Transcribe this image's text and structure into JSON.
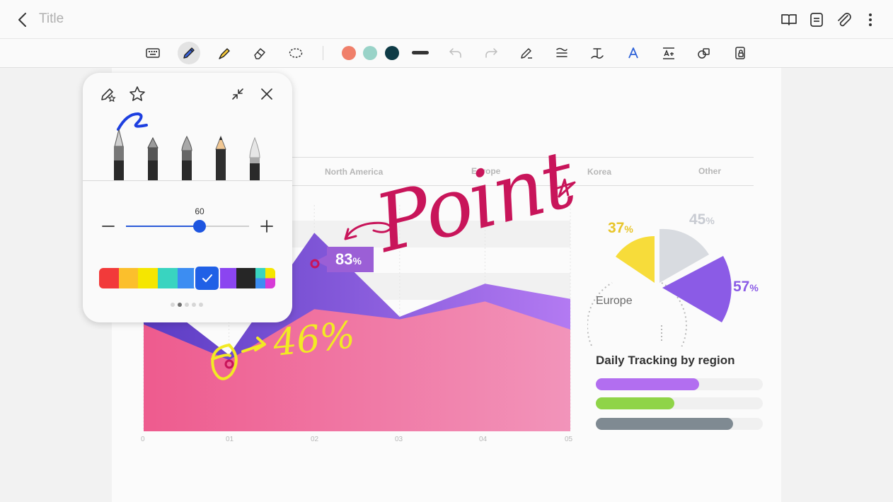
{
  "topbar": {
    "title": "Title"
  },
  "toolbar": {
    "tools": [
      {
        "name": "keyboard-icon"
      },
      {
        "name": "pen-icon",
        "active": true
      },
      {
        "name": "highlighter-icon"
      },
      {
        "name": "eraser-icon"
      },
      {
        "name": "lasso-icon"
      }
    ],
    "swatches": [
      "#f07f6a",
      "#99d3c8",
      "#0e3b46"
    ],
    "right_tools": [
      "undo-icon",
      "redo-icon",
      "pen-selection-icon",
      "straighten-icon",
      "handwriting-to-text-icon",
      "text-style-icon",
      "text-reflow-icon",
      "shape-icon",
      "lock-icon"
    ]
  },
  "canvas": {
    "regions": [
      "North America",
      "Europe",
      "Korea",
      "Other"
    ],
    "x_ticks": [
      "0",
      "01",
      "02",
      "03",
      "04",
      "05"
    ],
    "callout_83": {
      "value": "83",
      "unit": "%"
    },
    "pie": {
      "yellow": {
        "value": "37",
        "unit": "%",
        "color": "#f7dc3a"
      },
      "gray": {
        "value": "45",
        "unit": "%",
        "color": "#d8dbe0"
      },
      "purple": {
        "value": "57",
        "unit": "%",
        "color": "#8b5be6"
      },
      "label": "Europe"
    },
    "tracking": {
      "title": "Daily Tracking by region",
      "bars": [
        {
          "color": "#b26ef0",
          "fraction": 0.62
        },
        {
          "color": "#8fd448",
          "fraction": 0.47
        },
        {
          "color": "#7f8a92",
          "fraction": 0.82
        }
      ]
    },
    "handwriting": {
      "point_text": "Point",
      "percent_text": "46%"
    }
  },
  "chart_data": {
    "type": "area",
    "categories": [
      "0",
      "01",
      "02",
      "03",
      "04",
      "05"
    ],
    "series": [
      {
        "values": [
          56,
          30,
          78,
          45,
          58,
          52
        ],
        "color": "#7c4bd6"
      },
      {
        "values": [
          42,
          28,
          48,
          44,
          51,
          40
        ],
        "color": "#f07aa0"
      }
    ],
    "ylim": [
      0,
      100
    ]
  },
  "pen_panel": {
    "pens": [
      "fountain-pen-icon",
      "calligraphy-pen-icon",
      "brush-pen-icon",
      "pencil-icon",
      "marker-pen-icon"
    ],
    "size_value": "60",
    "size_fraction": 0.6,
    "palette": [
      "#f23a3a",
      "#fbbf2c",
      "#f5e600",
      "#39d4c0",
      "#3c8df2",
      "#1b5ee8",
      "#8b45f0",
      "#262626"
    ],
    "page_dots": 5,
    "active_dot": 1
  }
}
